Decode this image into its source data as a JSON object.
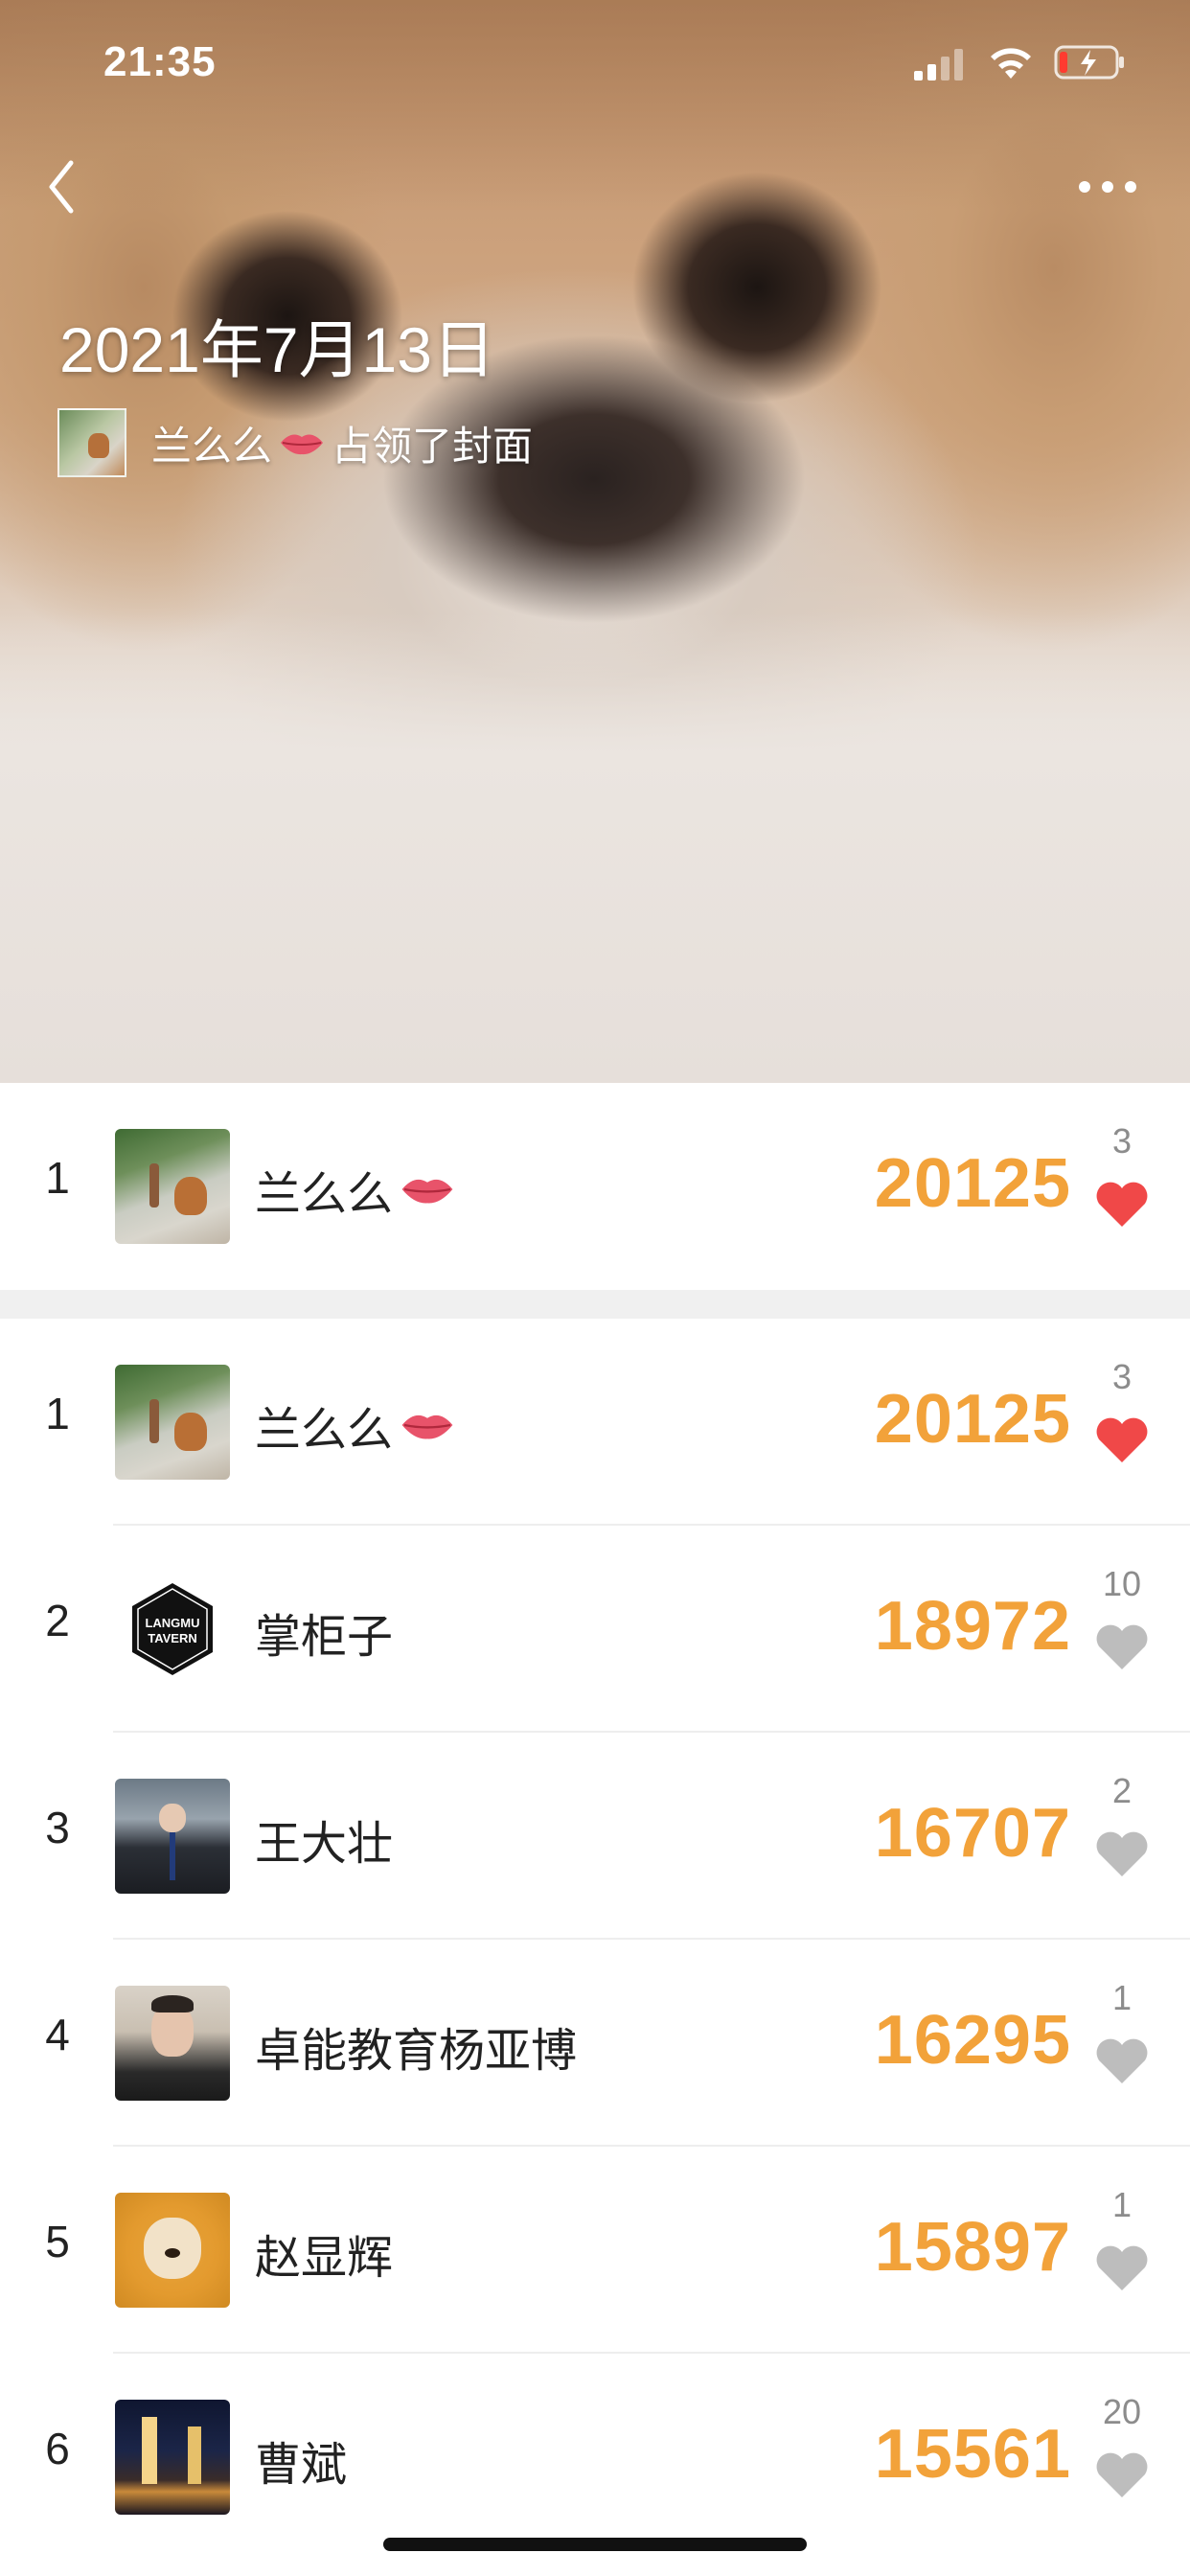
{
  "status_bar": {
    "time": "21:35",
    "icons": [
      "signal-icon",
      "wifi-icon",
      "battery-charging-icon"
    ]
  },
  "header": {
    "back_icon": "chevron-left-icon",
    "more_icon": "more-dots-icon",
    "date": "2021年7月13日",
    "owner_name": "兰么么",
    "owner_action": "占领了封面"
  },
  "my_rank": {
    "rank": "1",
    "name": "兰么么",
    "score": "20125",
    "likes": "3",
    "liked": true
  },
  "ranking": [
    {
      "rank": "1",
      "name": "兰么么",
      "score": "20125",
      "likes": "3",
      "liked": true,
      "lips": true
    },
    {
      "rank": "2",
      "name": "掌柜子",
      "score": "18972",
      "likes": "10",
      "liked": false,
      "lips": false
    },
    {
      "rank": "3",
      "name": "王大壮",
      "score": "16707",
      "likes": "2",
      "liked": false,
      "lips": false
    },
    {
      "rank": "4",
      "name": "卓能教育杨亚博",
      "score": "16295",
      "likes": "1",
      "liked": false,
      "lips": false
    },
    {
      "rank": "5",
      "name": "赵显辉",
      "score": "15897",
      "likes": "1",
      "liked": false,
      "lips": false
    },
    {
      "rank": "6",
      "name": "曹斌",
      "score": "15561",
      "likes": "20",
      "liked": false,
      "lips": false
    }
  ],
  "logo_text": [
    "LANGMU",
    "TAVERN"
  ],
  "colors": {
    "score": "#f2a23a",
    "heart_active": "#f04848",
    "heart_inactive": "#bdbdbd",
    "divider": "#f0f0f0"
  }
}
